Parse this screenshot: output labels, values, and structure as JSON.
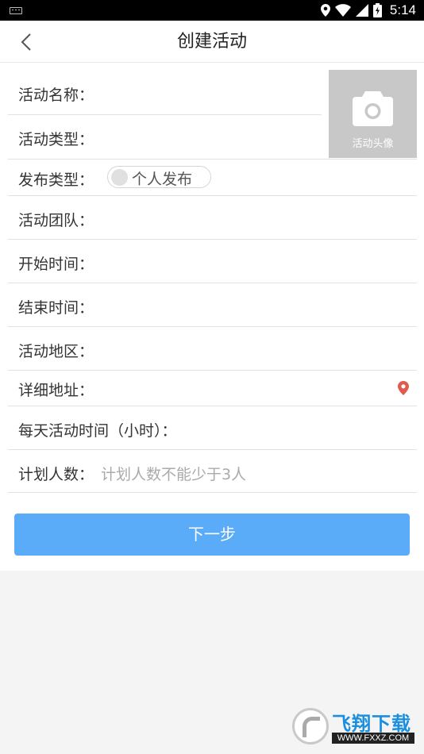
{
  "status_bar": {
    "time": "5:14"
  },
  "header": {
    "title": "创建活动"
  },
  "avatar": {
    "caption": "活动头像"
  },
  "fields": {
    "name": "活动名称：",
    "type": "活动类型：",
    "publish_type": "发布类型：",
    "publish_toggle": "个人发布",
    "team": "活动团队：",
    "start_time": "开始时间：",
    "end_time": "结束时间：",
    "region": "活动地区：",
    "address": "详细地址：",
    "daily_hours": "每天活动时间（小时）：",
    "planned_count": "计划人数：",
    "planned_count_placeholder": "计划人数不能少于3人"
  },
  "next_button": "下一步",
  "watermark": {
    "brand": "飞翔下载",
    "url": "WWW.FXXZ.COM"
  },
  "colors": {
    "primary_button": "#5aacf8",
    "pin": "#e05a4f",
    "avatar_bg": "#c8c8c8"
  }
}
